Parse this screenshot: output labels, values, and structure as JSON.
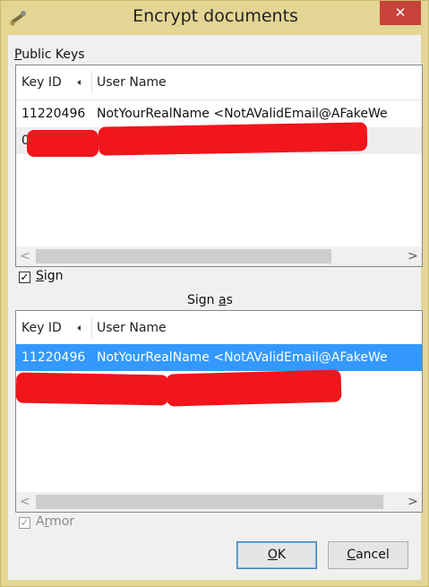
{
  "window": {
    "title": "Encrypt documents",
    "close_glyph": "✕"
  },
  "public_keys": {
    "label_first": "P",
    "label_rest": "ublic Keys",
    "columns": {
      "key_id": "Key ID",
      "user_name": "User Name"
    },
    "rows": [
      {
        "key_id": "11220496",
        "user_name": "NotYourRealName <NotAValidEmail@AFakeWe"
      },
      {
        "key_id": "0",
        "user_name": ""
      }
    ]
  },
  "sign": {
    "checked": true,
    "label_first": "S",
    "label_rest": "ign"
  },
  "sign_as": {
    "label_pre": "Sign ",
    "label_u": "a",
    "label_post": "s",
    "columns": {
      "key_id": "Key ID",
      "user_name": "User Name"
    },
    "rows": [
      {
        "key_id": "11220496",
        "user_name": "NotYourRealName <NotAValidEmail@AFakeWe"
      }
    ]
  },
  "armor": {
    "checked": true,
    "disabled": true,
    "label_pre": "A",
    "label_u": "r",
    "label_post": "mor"
  },
  "buttons": {
    "ok_u": "O",
    "ok_rest": "K",
    "cancel_u": "C",
    "cancel_rest": "ancel"
  },
  "scroll": {
    "left": "<",
    "right": ">"
  },
  "icons": {
    "app": "key-wand-icon",
    "sort": "sort-left-arrow-icon"
  },
  "colors": {
    "selection": "#3399ff",
    "redaction": "#f0161b",
    "close": "#c7423a"
  }
}
